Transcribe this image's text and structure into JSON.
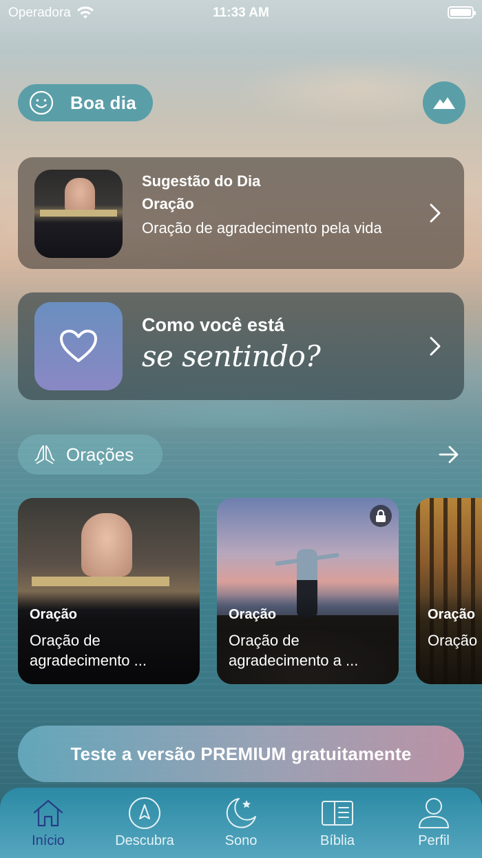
{
  "status_bar": {
    "carrier": "Operadora",
    "time": "11:33 AM"
  },
  "greeting": {
    "label": "Boa dia",
    "icon": "smile-icon"
  },
  "scenery_button": {
    "icon": "mountain-icon"
  },
  "suggestion": {
    "title": "Sugestão do Dia",
    "category": "Oração",
    "description": "Oração de agradecimento pela vida"
  },
  "feeling": {
    "line1": "Como você está",
    "line2": "se sentindo?",
    "icon": "heart-icon"
  },
  "prayers_section": {
    "title": "Orações",
    "icon": "praying-hands-icon"
  },
  "prayer_cards": [
    {
      "category": "Oração",
      "title": "Oração de agradecimento ...",
      "locked": false
    },
    {
      "category": "Oração",
      "title": "Oração de agradecimento a ...",
      "locked": true
    },
    {
      "category": "Oração",
      "title": "Oração afastar",
      "locked": false
    }
  ],
  "premium": {
    "label": "Teste a versão PREMIUM gratuitamente"
  },
  "tabs": [
    {
      "label": "Início",
      "icon": "home-icon",
      "active": true
    },
    {
      "label": "Descubra",
      "icon": "compass-icon",
      "active": false
    },
    {
      "label": "Sono",
      "icon": "moon-icon",
      "active": false
    },
    {
      "label": "Bíblia",
      "icon": "book-icon",
      "active": false
    },
    {
      "label": "Perfil",
      "icon": "user-icon",
      "active": false
    }
  ],
  "colors": {
    "pill": "#5a9ea8",
    "tab_active": "#263c85",
    "tab_bar": "#2b8aa4"
  }
}
